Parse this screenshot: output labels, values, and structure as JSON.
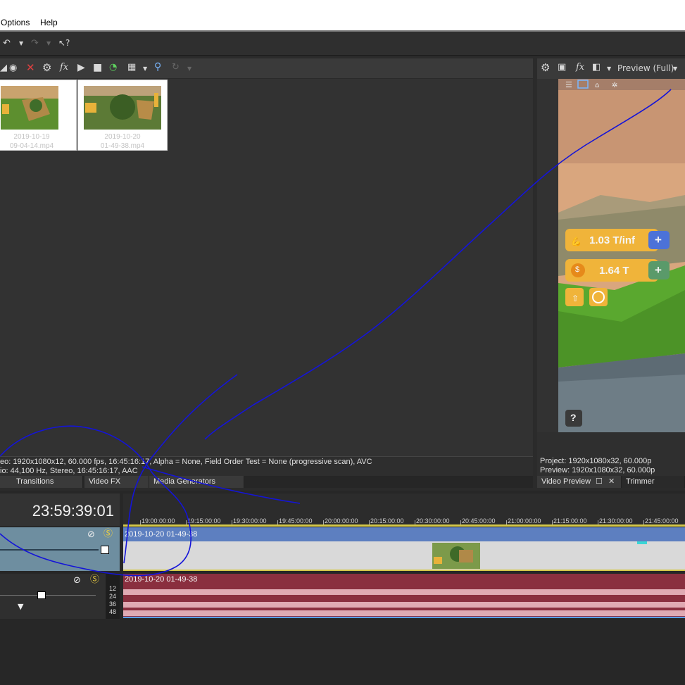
{
  "menu": {
    "options": "Options",
    "help": "Help"
  },
  "media": {
    "items": [
      {
        "date": "2019-10-19",
        "time": "09-04-14.mp4"
      },
      {
        "date": "2019-10-20",
        "time": "01-49-38.mp4"
      }
    ],
    "info_video": "eo: 1920x1080x12, 60.000 fps, 16:45:16:17, Alpha = None, Field Order Test = None (progressive scan), AVC",
    "info_audio": "io: 44,100 Hz, Stereo, 16:45:16:17, AAC",
    "tabs": [
      "Transitions",
      "Video FX",
      "Media Generators"
    ]
  },
  "preview": {
    "mode": "Preview (Full)",
    "project": "Project:   1920x1080x32, 60.000p",
    "preview_res": "Preview:  1920x1080x32, 60.000p",
    "tab_video_preview": "Video Preview",
    "tab_trimmer": "Trimmer",
    "game": {
      "strength": "1.03 T/inf",
      "coins": "1.64 T",
      "help": "?",
      "plus": "+"
    }
  },
  "timeline": {
    "timecode": "23:59:39:01",
    "ticks": [
      "19:00:00:00",
      "19:15:00:00",
      "19:30:00:00",
      "19:45:00:00",
      "20:00:00:00",
      "20:15:00:00",
      "20:30:00:00",
      "20:45:00:00",
      "21:00:00:00",
      "21:15:00:00",
      "21:30:00:00",
      "21:45:00:00"
    ],
    "video_event": "2019-10-20 01-49-38",
    "audio_event": "2019-10-20 01-49-38",
    "audio_levels": [
      "12",
      "24",
      "36",
      "48"
    ]
  },
  "colors": {
    "video_header": "#5d7fc0",
    "audio_track": "#8a2f3f",
    "annotation": "#1414d8"
  }
}
